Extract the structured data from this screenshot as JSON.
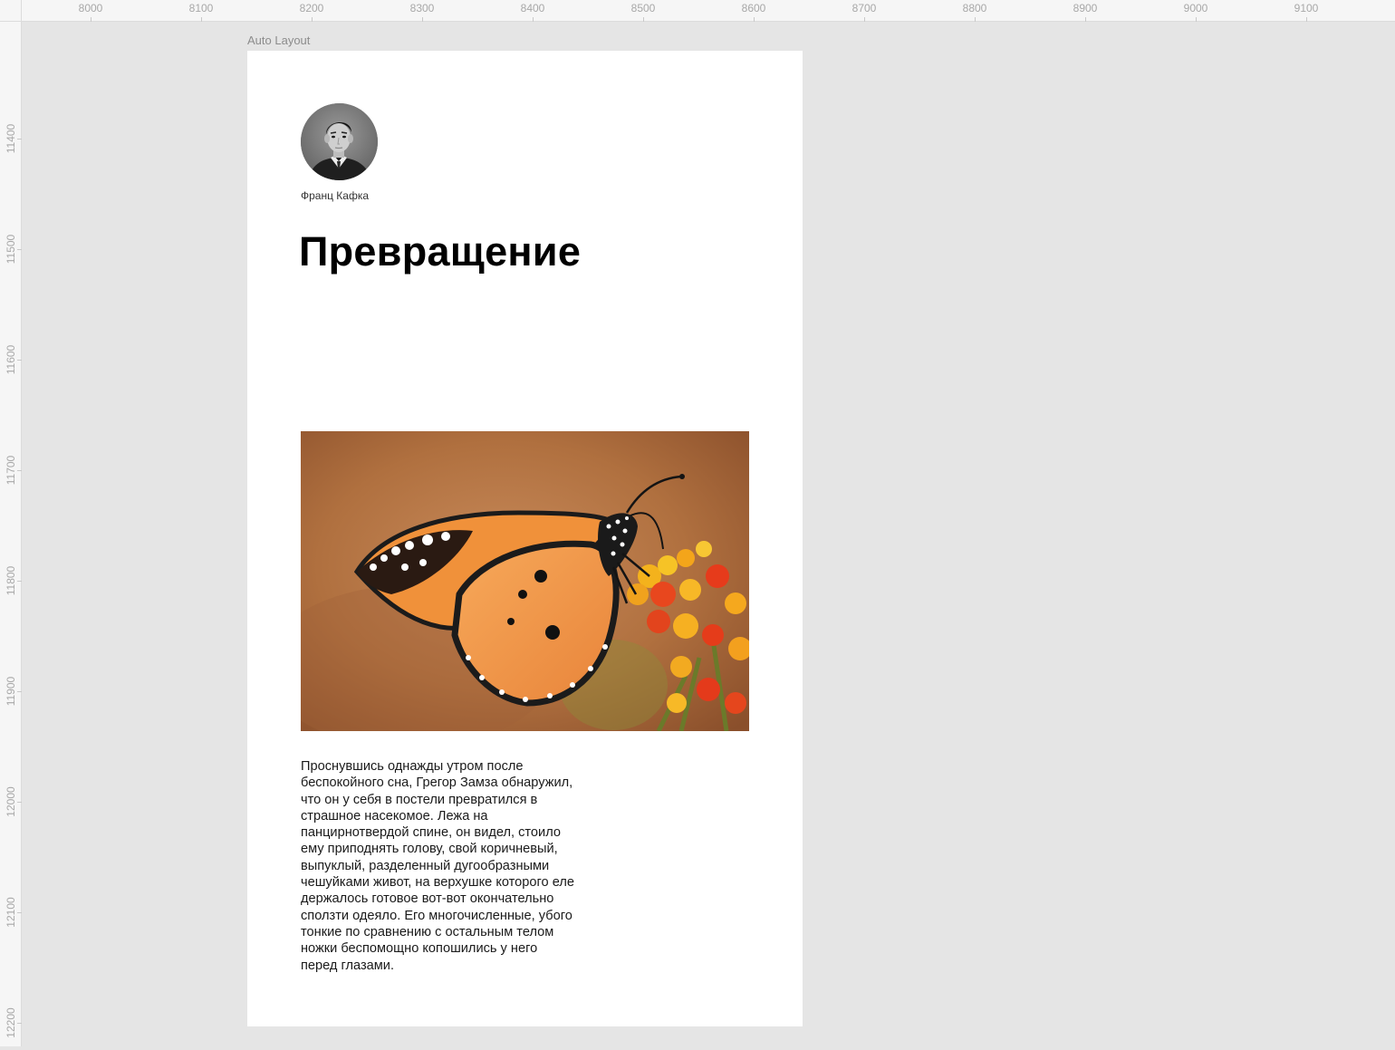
{
  "rulers": {
    "x": [
      "8000",
      "8100",
      "8200",
      "8300",
      "8400",
      "8500",
      "8600",
      "8700",
      "8800",
      "8900",
      "9000",
      "9100"
    ],
    "y": [
      "11400",
      "11500",
      "11600",
      "11700",
      "11800",
      "11900",
      "12000",
      "12100",
      "12200"
    ]
  },
  "frame": {
    "label": "Auto Layout",
    "author": "Франц Кафка",
    "title": "Превращение",
    "body_lines": [
      "Проснувшись однажды утром после",
      "беспокойного сна, Грегор Замза обнаружил,",
      "что он у себя в постели превратился в",
      "страшное насекомое. Лежа на",
      "панцирнотвердой спине, он видел, стоило",
      "ему приподнять голову, свой коричневый,",
      "выпуклый, разделенный дугообразными",
      "чешуйками живот, на верхушке которого еле",
      "держалось готовое вот-вот окончательно",
      "сползти одеяло. Его многочисленные, убого",
      "тонкие по сравнению с остальным телом",
      "ножки беспомощно копошились у него",
      "перед глазами."
    ]
  },
  "colors": {
    "canvas": "#e5e5e5",
    "frame": "#ffffff",
    "butterfly_orange": "#f0913a"
  },
  "icons": {
    "avatar": "portrait-photo",
    "hero": "butterfly-photo"
  }
}
